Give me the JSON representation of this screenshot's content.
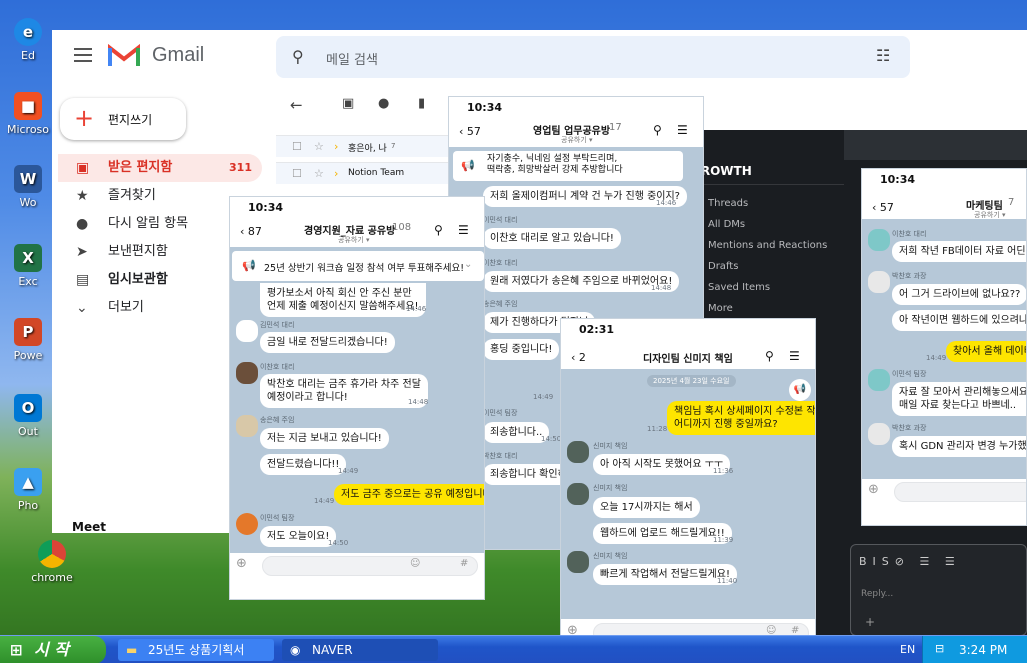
{
  "desktop": {
    "icons": [
      "Ed",
      "Microso",
      "Wo",
      "Exc",
      "Powe",
      "Out",
      "Pho"
    ],
    "chrome_label": "chrome"
  },
  "taskbar": {
    "start": "시 작",
    "items": [
      "25년도 상품기획서",
      "NAVER"
    ],
    "lang": "EN",
    "clock": "3:24 PM"
  },
  "gmail": {
    "brand": "Gmail",
    "search_placeholder": "메일 검색",
    "compose": "편지쓰기",
    "nav": [
      {
        "label": "받은 편지함",
        "count": "311"
      },
      {
        "label": "즐겨찾기"
      },
      {
        "label": "다시 알림 항목"
      },
      {
        "label": "보낸편지함"
      },
      {
        "label": "임시보관함"
      },
      {
        "label": "더보기"
      }
    ],
    "meet": "Meet",
    "rows": [
      {
        "sender": "홍은아, 나",
        "count": "7"
      },
      {
        "sender": "Notion Team"
      }
    ]
  },
  "chat1": {
    "time": "10:34",
    "back": "87",
    "title": "경영지원_자료 공유방",
    "members": "108",
    "sub": "공유하기 ▾",
    "notice": "25년 상반기 워크숍 일정 참석 여부 투표해주세요!",
    "msgs": [
      {
        "text": "평가보소서 아직 회신 안 주신 분만\n언제 제출 예정이신지 말씀해주세요!",
        "time": "14:46"
      },
      {
        "sender": "김민석 대리",
        "text": "금일 내로 전달드리겠습니다!",
        "time": ""
      },
      {
        "sender": "이찬호 대리",
        "text": "박찬호 대리는 금주 휴가라 차주 전달\n예정이라고 합니다!",
        "time": "14:48"
      },
      {
        "sender": "송은혜 주임",
        "text": "저는 지금 보내고 있습니다!",
        "time": ""
      },
      {
        "text": "전달드렸습니다!!",
        "time": "14:49"
      },
      {
        "mine": true,
        "text": "저도 금주 중으로는 공유 예정입니다!",
        "time": "14:49"
      },
      {
        "sender": "이민석 팀장",
        "text": "저도 오늘이요!",
        "time": "14:50"
      }
    ]
  },
  "chat2": {
    "time": "10:34",
    "back": "57",
    "title": "영업팀 업무공유방",
    "members": "17",
    "sub": "공유하기 ▾",
    "notice": "자기충수, 닉네임 설정 부탁드리며,\n떡락충, 희망박살러 강제 추방합니다",
    "msgs": [
      {
        "text": "저희 올제이컴퍼니 계약 건 누가 진행 중이지?",
        "time": "14:46"
      },
      {
        "sender": "이민석 대리",
        "text": "이찬호 대리로 알고 있습니다!",
        "time": ""
      },
      {
        "sender": "이찬호 대리",
        "text": "원래 저였다가 송은혜 주임으로 바뀌었어요!",
        "time": "14:48"
      },
      {
        "sender": "송은혜 주임",
        "text": "제가 진행하다가 팀장님",
        "time": ""
      },
      {
        "text": "홍딩 중입니다!",
        "time": "14:49"
      },
      {
        "sender": "이민석 팀장",
        "text": "죄송합니다..",
        "time": "14:50"
      },
      {
        "sender": "박찬호 대리",
        "text": "죄송합니다 확인하겠",
        "time": ""
      }
    ]
  },
  "chat3": {
    "time": "02:31",
    "back": "2",
    "title": "디자인팀 신미지 책임",
    "date": "2025년 4월 23일 수요일",
    "msgs": [
      {
        "mine": true,
        "text": "책임님 혹시 상세페이지 수정본 작업\n어디까지 진행 중일까요?",
        "time": "11:28"
      },
      {
        "sender": "신미지 책임",
        "text": "아 아직 시작도 못했어요 ㅜㅜ",
        "time": "11:36"
      },
      {
        "sender": "신미지 책임",
        "text": "오늘 17시까지는 해서",
        "time": ""
      },
      {
        "text": "웹하드에 업로드 해드릴게요!!",
        "time": "11:39"
      },
      {
        "sender": "신미지 책임",
        "text": "빠르게 작업해서 전달드릴게요!",
        "time": "11:40"
      }
    ]
  },
  "chat4": {
    "time": "10:34",
    "back": "57",
    "title": "마케팅팀",
    "members": "7",
    "sub": "공유하기 ▾",
    "msgs": [
      {
        "sender": "이찬호 대리",
        "text": "저희 작년 FB데이터 자료 어딘는지",
        "time": ""
      },
      {
        "sender": "박찬호 과장",
        "text": "어 그거 드라이브에 없나요??",
        "time": ""
      },
      {
        "text": "아 작년이면 웹하드에 있으려나",
        "time": ""
      },
      {
        "mine": true,
        "text": "찾아서 올해 데이터랑",
        "time": "14:49"
      },
      {
        "sender": "이민석 팀장",
        "text": "자료 잘 모아서 관리해놓으세요\n매일 자료 찾는다고 바쁘네..",
        "time": ""
      },
      {
        "sender": "박찬호 과장",
        "text": "혹시 GDN 관리자 변경 누가했는지",
        "time": ""
      }
    ]
  },
  "slack": {
    "workspace": "GROWTH",
    "items": [
      "Threads",
      "All DMs",
      "Mentions and Reactions",
      "Drafts",
      "Saved Items",
      "More"
    ],
    "reply_placeholder": "Reply..."
  },
  "colors": {
    "gmail_red": "#d93025",
    "kakao_yellow": "#fee500",
    "kakao_bg": "#b6c8d8",
    "slack_bg": "#1a1d21"
  }
}
